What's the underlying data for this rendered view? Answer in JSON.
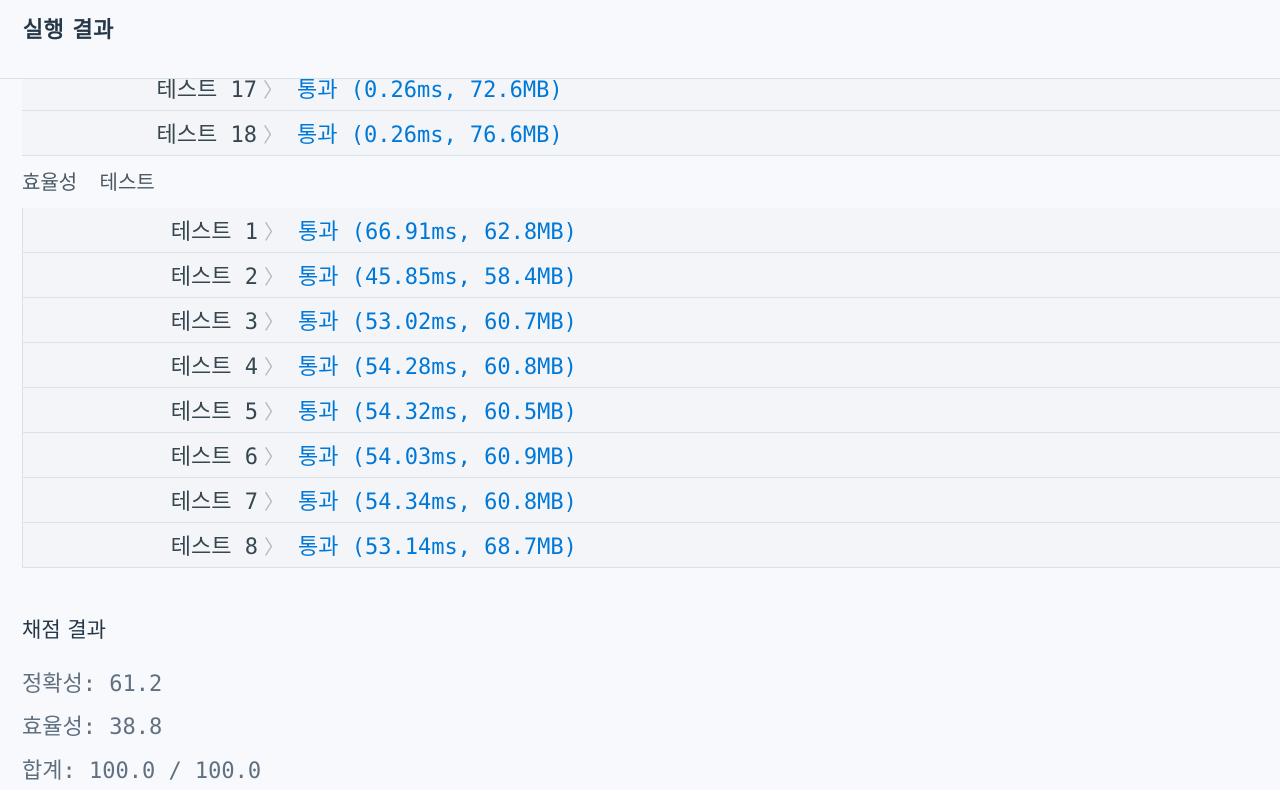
{
  "header": {
    "title": "실행 결과"
  },
  "accuracy_tail": {
    "rows": [
      {
        "label": "테스트 17",
        "result": "통과 (0.26ms, 72.6MB)"
      },
      {
        "label": "테스트 18",
        "result": "통과 (0.26ms, 76.6MB)"
      }
    ]
  },
  "efficiency": {
    "section_label": "효율성 테스트",
    "rows": [
      {
        "label": "테스트 1",
        "result": "통과 (66.91ms, 62.8MB)"
      },
      {
        "label": "테스트 2",
        "result": "통과 (45.85ms, 58.4MB)"
      },
      {
        "label": "테스트 3",
        "result": "통과 (53.02ms, 60.7MB)"
      },
      {
        "label": "테스트 4",
        "result": "통과 (54.28ms, 60.8MB)"
      },
      {
        "label": "테스트 5",
        "result": "통과 (54.32ms, 60.5MB)"
      },
      {
        "label": "테스트 6",
        "result": "통과 (54.03ms, 60.9MB)"
      },
      {
        "label": "테스트 7",
        "result": "통과 (54.34ms, 60.8MB)"
      },
      {
        "label": "테스트 8",
        "result": "통과 (53.14ms, 68.7MB)"
      }
    ]
  },
  "score": {
    "title": "채점 결과",
    "accuracy": "정확성: 61.2",
    "efficiency": "효율성: 38.8",
    "total": "합계: 100.0 / 100.0"
  },
  "colors": {
    "pass": "#0078d7",
    "label": "#37474f",
    "border": "#d7e2eb",
    "background": "#f8f9fc"
  },
  "icons": {
    "row_separator": "chevron-right-icon",
    "panel_handle": "drag-handle-icon"
  }
}
